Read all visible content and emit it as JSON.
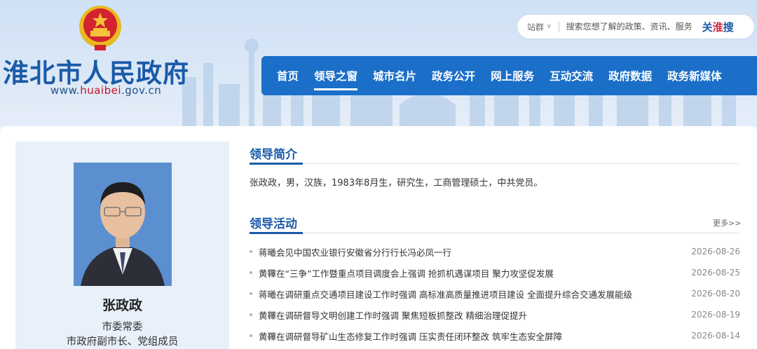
{
  "header": {
    "title": "淮北市人民政府",
    "url_prefix": "www.",
    "url_highlight": "huaibei",
    "url_suffix": ".gov.cn",
    "emblem_icon": "national-emblem-icon"
  },
  "search": {
    "scope_label": "站群",
    "placeholder": "搜索您想了解的政策、资讯、服务",
    "brand_a": "关",
    "brand_b": "淮",
    "brand_c": "搜"
  },
  "nav": {
    "items": [
      {
        "label": "首页"
      },
      {
        "label": "领导之窗"
      },
      {
        "label": "城市名片"
      },
      {
        "label": "政务公开"
      },
      {
        "label": "网上服务"
      },
      {
        "label": "互动交流"
      },
      {
        "label": "政府数据"
      },
      {
        "label": "政务新媒体"
      }
    ],
    "active_index": 1
  },
  "profile": {
    "name": "张政政",
    "role_line1": "市委常委",
    "role_line2": "市政府副市长、党组成员"
  },
  "intro": {
    "section_title": "领导简介",
    "text": "张政政，男，汉族，1983年8月生，研究生，工商管理硕士，中共党员。"
  },
  "activities": {
    "section_title": "领导活动",
    "more_label": "更多>>",
    "items": [
      {
        "title": "蒋曦会见中国农业银行安徽省分行行长冯必凤一行",
        "date": "2026-08-26"
      },
      {
        "title": "黄鞸在“三争”工作暨重点项目调度会上强调 抢抓机遇谋项目 聚力攻坚促发展",
        "date": "2026-08-25"
      },
      {
        "title": "蒋曦在调研重点交通项目建设工作时强调 高标准高质量推进项目建设 全面提升综合交通发展能级",
        "date": "2026-08-20"
      },
      {
        "title": "黄鞸在调研督导文明创建工作时强调 聚焦短板抓整改 精细治理促提升",
        "date": "2026-08-19"
      },
      {
        "title": "黄鞸在调研督导矿山生态修复工作时强调 压实责任闭环整改 筑牢生态安全屏障",
        "date": "2026-08-14"
      }
    ]
  },
  "colors": {
    "brand_blue": "#1a5aa8",
    "nav_blue": "#1b6fc9",
    "accent_red": "#c8102e"
  }
}
